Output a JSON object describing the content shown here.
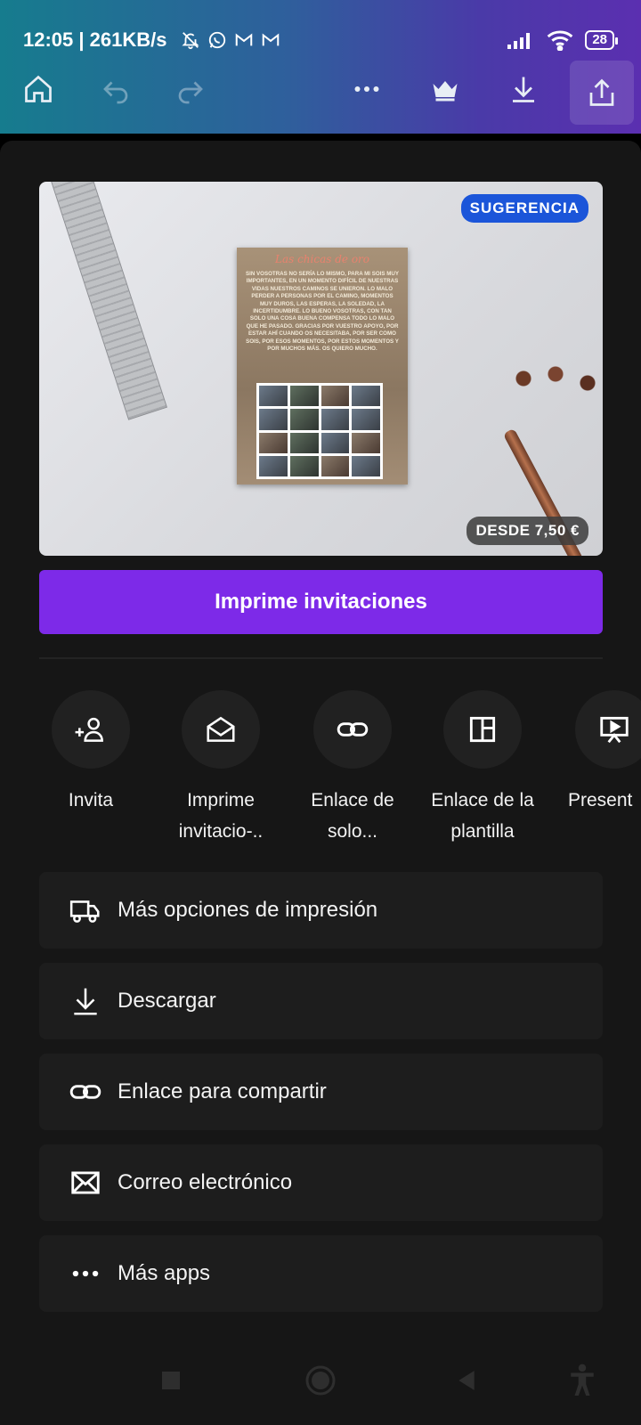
{
  "status_bar": {
    "time_speed": "12:05 | 261KB/s",
    "battery": "28"
  },
  "toolbar": {
    "icons": [
      "home-icon",
      "undo-icon",
      "redo-icon",
      "more-icon",
      "crown-icon",
      "download-icon",
      "share-icon"
    ]
  },
  "preview": {
    "badge_top": "SUGERENCIA",
    "badge_price": "DESDE 7,50 €",
    "card_title": "Las chicas de oro",
    "card_text": "Sin vosotras no sería lo mismo, para mi sois muy importantes, en un momento difícil de nuestras vidas nuestros caminos se unieron. Lo malo perder a personas por el camino, momentos muy duros, las esperas, la soledad, la incertidumbre. Lo bueno vosotras, con tan solo una cosa buena compensa todo lo malo que he pasado. Gracias por vuestro apoyo, por estar ahí cuando os necesitaba, por ser como sois, por esos momentos, por estos momentos y por muchos más. Os quiero mucho."
  },
  "print_button": "Imprime invitaciones",
  "quick_actions": [
    {
      "label": "Invita",
      "icon": "add-people-icon"
    },
    {
      "label": "Imprime invitacio-..",
      "icon": "envelope-open-icon"
    },
    {
      "label": "Enlace de solo...",
      "icon": "link-icon"
    },
    {
      "label": "Enlace de la plantilla",
      "icon": "template-icon"
    },
    {
      "label": "Present",
      "icon": "presentation-icon"
    }
  ],
  "options": [
    {
      "label": "Más opciones de impresión",
      "icon": "truck-icon"
    },
    {
      "label": "Descargar",
      "icon": "download-icon"
    },
    {
      "label": "Enlace para compartir",
      "icon": "link-icon"
    },
    {
      "label": "Correo electrónico",
      "icon": "mail-icon"
    },
    {
      "label": "Más apps",
      "icon": "more-icon"
    }
  ],
  "colors": {
    "accent": "#7d2ae8",
    "badge_blue": "#1b55d9",
    "sheet_bg": "#161616"
  }
}
